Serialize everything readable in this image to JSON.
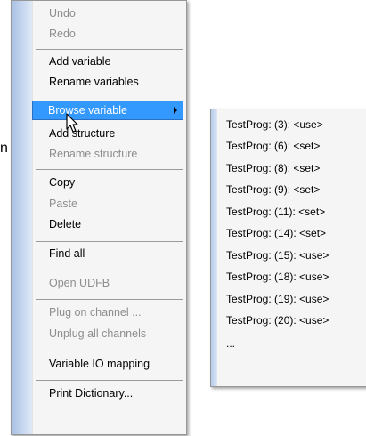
{
  "background": {
    "fragment_text": "n"
  },
  "menu": {
    "items": [
      {
        "label": "Undo",
        "disabled": true
      },
      {
        "label": "Redo",
        "disabled": true
      },
      {
        "label": "Add variable",
        "disabled": false
      },
      {
        "label": "Rename variables",
        "disabled": false
      },
      {
        "label": "Browse variable",
        "disabled": false,
        "highlighted": true,
        "has_submenu": true
      },
      {
        "label": "Add structure",
        "disabled": false
      },
      {
        "label": "Rename structure",
        "disabled": true
      },
      {
        "label": "Copy",
        "disabled": false
      },
      {
        "label": "Paste",
        "disabled": true
      },
      {
        "label": "Delete",
        "disabled": false
      },
      {
        "label": "Find all",
        "disabled": false
      },
      {
        "label": "Open UDFB",
        "disabled": true
      },
      {
        "label": "Plug on channel ...",
        "disabled": true
      },
      {
        "label": "Unplug all channels",
        "disabled": true
      },
      {
        "label": "Variable IO mapping",
        "disabled": false
      },
      {
        "label": "Print Dictionary...",
        "disabled": false
      }
    ]
  },
  "submenu": {
    "items": [
      {
        "label": "TestProg: (3): <use>"
      },
      {
        "label": "TestProg: (6): <set>"
      },
      {
        "label": "TestProg: (8): <set>"
      },
      {
        "label": "TestProg: (9): <set>"
      },
      {
        "label": "TestProg: (11): <set>"
      },
      {
        "label": "TestProg: (14): <set>"
      },
      {
        "label": "TestProg: (15): <use>"
      },
      {
        "label": "TestProg: (18): <use>"
      },
      {
        "label": "TestProg: (19): <use>"
      },
      {
        "label": "TestProg: (20): <use>"
      },
      {
        "label": "..."
      }
    ]
  },
  "colors": {
    "highlight": "#3399ff",
    "menu_background": "#f5f5f5",
    "disabled_text": "#8d8d8d",
    "gutter": "#a8c0e4"
  }
}
